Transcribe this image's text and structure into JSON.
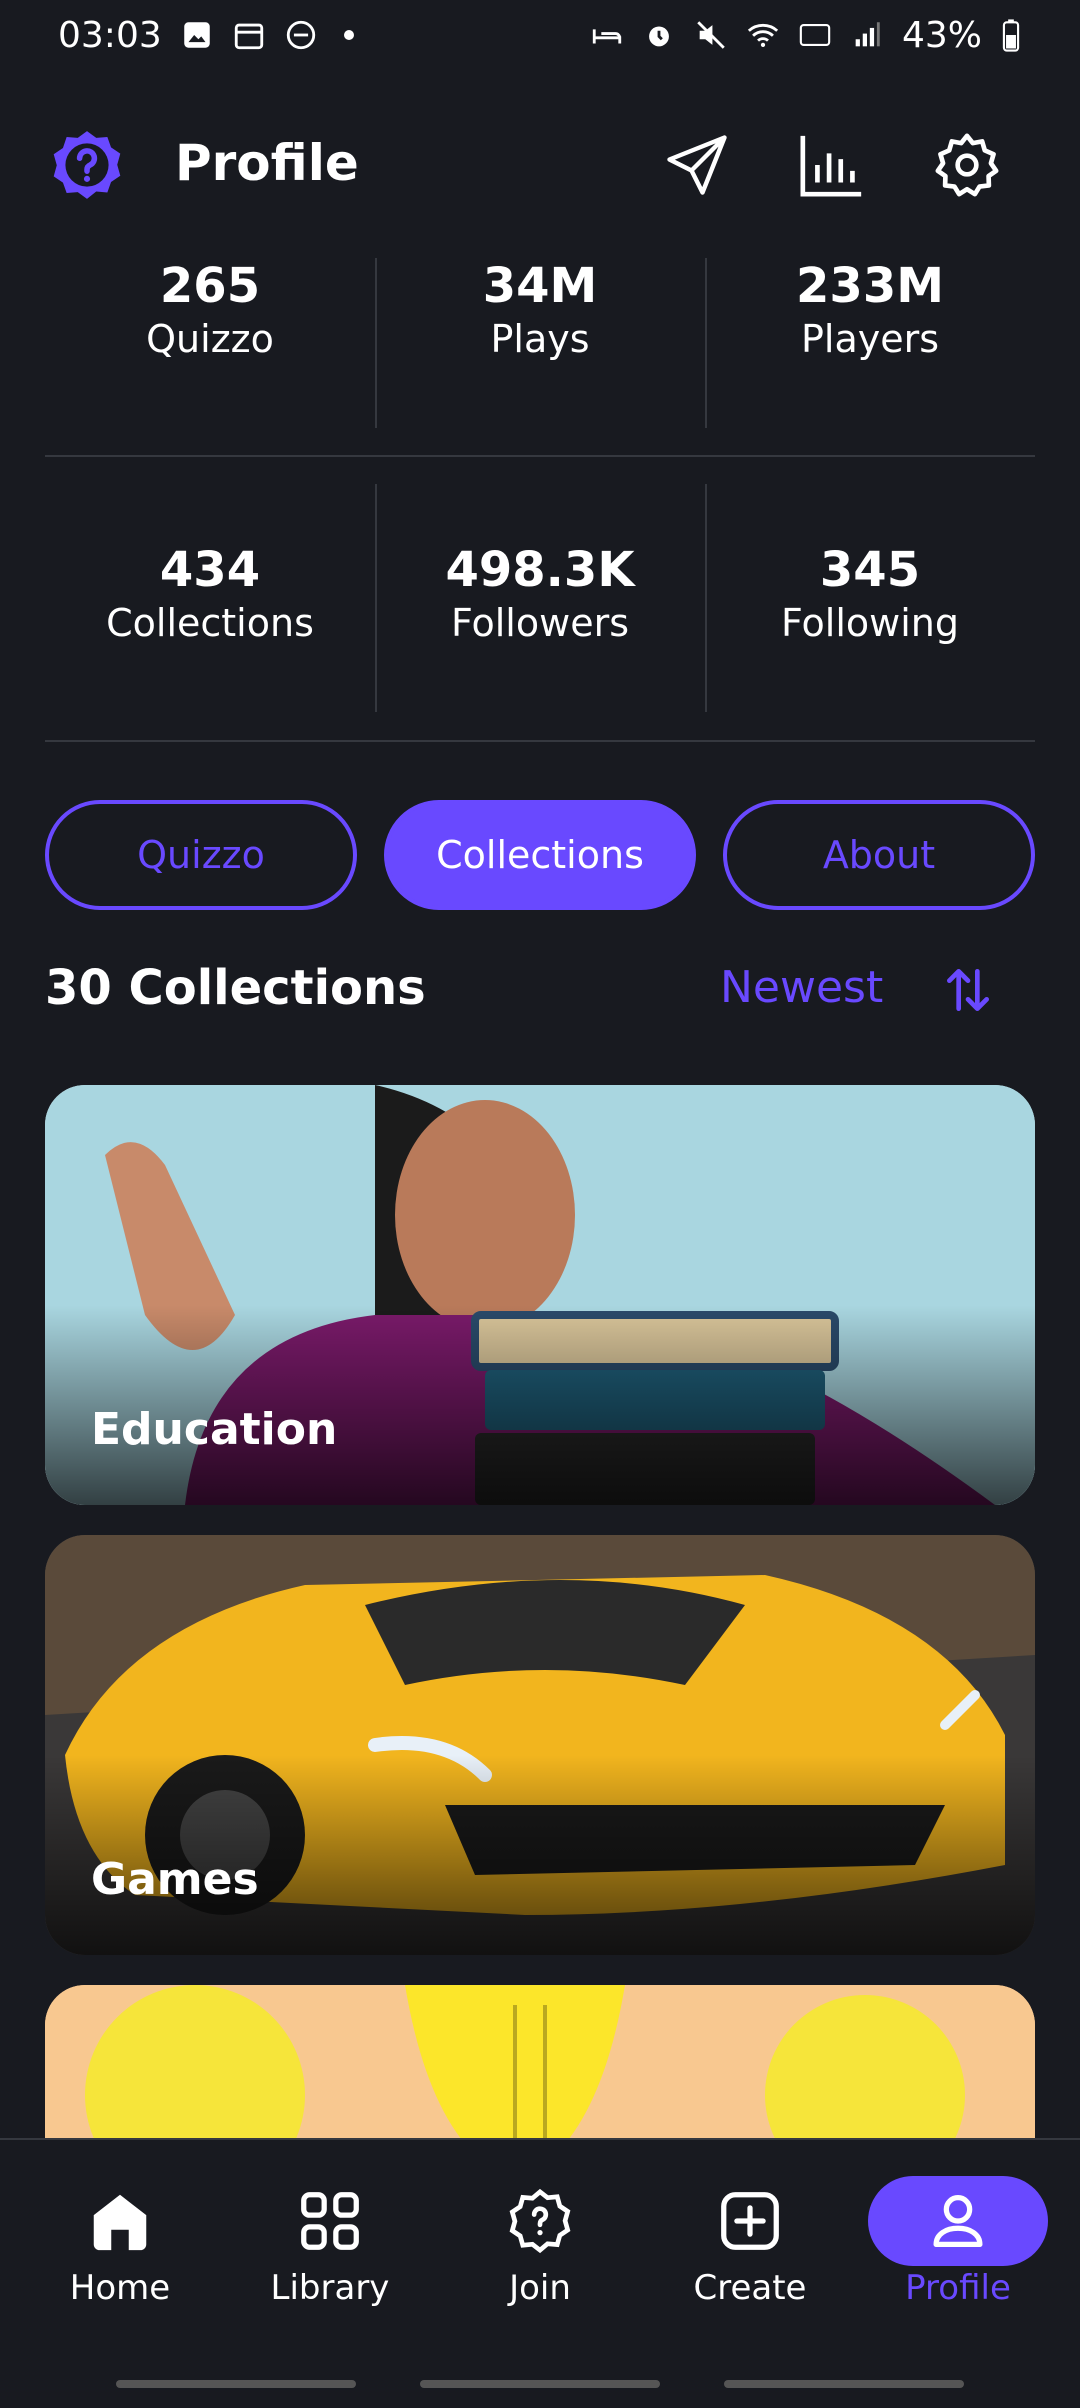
{
  "status_bar": {
    "time": "03:03",
    "battery": "43%"
  },
  "header": {
    "title": "Profile"
  },
  "stats": {
    "row1": [
      {
        "value": "265",
        "label": "Quizzo"
      },
      {
        "value": "34M",
        "label": "Plays"
      },
      {
        "value": "233M",
        "label": "Players"
      }
    ],
    "row2": [
      {
        "value": "434",
        "label": "Collections"
      },
      {
        "value": "498.3K",
        "label": "Followers"
      },
      {
        "value": "345",
        "label": "Following"
      }
    ]
  },
  "tabs": [
    {
      "label": "Quizzo",
      "active": false
    },
    {
      "label": "Collections",
      "active": true
    },
    {
      "label": "About",
      "active": false
    }
  ],
  "section": {
    "title": "30 Collections",
    "sort_label": "Newest"
  },
  "collections": [
    {
      "label": "Education"
    },
    {
      "label": "Games"
    },
    {
      "label": ""
    }
  ],
  "nav": [
    {
      "label": "Home",
      "icon": "home-icon"
    },
    {
      "label": "Library",
      "icon": "grid-icon"
    },
    {
      "label": "Join",
      "icon": "quiz-badge-icon"
    },
    {
      "label": "Create",
      "icon": "plus-square-icon"
    },
    {
      "label": "Profile",
      "icon": "user-icon",
      "active": true
    }
  ],
  "colors": {
    "background": "#181A20",
    "accent": "#6949FF",
    "divider": "#35383F"
  }
}
